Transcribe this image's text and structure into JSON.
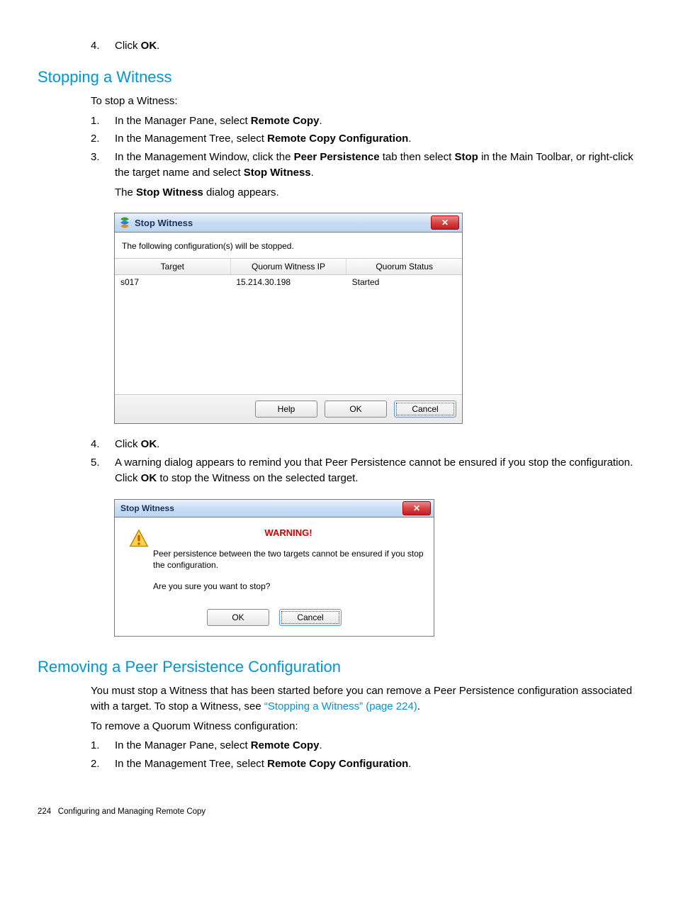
{
  "top": {
    "step4_num": "4.",
    "step4_text_pre": "Click ",
    "step4_bold": "OK",
    "step4_text_post": "."
  },
  "section1": {
    "heading": "Stopping a Witness",
    "intro": "To stop a Witness:",
    "s1_num": "1.",
    "s1_a": "In the Manager Pane, select ",
    "s1_b": "Remote Copy",
    "s1_c": ".",
    "s2_num": "2.",
    "s2_a": "In the Management Tree, select ",
    "s2_b": "Remote Copy Configuration",
    "s2_c": ".",
    "s3_num": "3.",
    "s3_a": "In the Management Window, click the ",
    "s3_b": "Peer Persistence",
    "s3_c": " tab then select ",
    "s3_d": "Stop",
    "s3_e": " in the Main Toolbar, or right-click the target name and select ",
    "s3_f": "Stop Witness",
    "s3_g": ".",
    "s3_line2a": "The ",
    "s3_line2b": "Stop Witness",
    "s3_line2c": " dialog appears."
  },
  "dialog1": {
    "title": "Stop Witness",
    "message": "The following configuration(s) will be stopped.",
    "col1": "Target",
    "col2": "Quorum Witness IP",
    "col3": "Quorum Status",
    "row1_target": "s017",
    "row1_ip": "15.214.30.198",
    "row1_status": "Started",
    "help": "Help",
    "ok": "OK",
    "cancel": "Cancel"
  },
  "after1": {
    "s4_num": "4.",
    "s4_a": "Click ",
    "s4_b": "OK",
    "s4_c": ".",
    "s5_num": "5.",
    "s5_a": "A warning dialog appears to remind you that Peer Persistence cannot be ensured if you stop the configuration. Click ",
    "s5_b": "OK",
    "s5_c": " to stop the Witness on the selected target."
  },
  "dialog2": {
    "title": "Stop Witness",
    "warning": "WARNING!",
    "msg1": "Peer persistence between the two targets cannot be ensured if you stop the configuration.",
    "msg2": "Are you sure you want to stop?",
    "ok": "OK",
    "cancel": "Cancel"
  },
  "section2": {
    "heading": "Removing a Peer Persistence Configuration",
    "p1a": "You must stop a Witness that has been started before you can remove a Peer Persistence configuration associated with a target. To stop a Witness, see ",
    "p1link": "“Stopping a Witness” (page 224)",
    "p1b": ".",
    "p2": "To remove a Quorum Witness configuration:",
    "s1_num": "1.",
    "s1_a": "In the Manager Pane, select ",
    "s1_b": "Remote Copy",
    "s1_c": ".",
    "s2_num": "2.",
    "s2_a": "In the Management Tree, select ",
    "s2_b": "Remote Copy Configuration",
    "s2_c": "."
  },
  "footer": {
    "page": "224",
    "chapter": "Configuring and Managing Remote Copy"
  }
}
